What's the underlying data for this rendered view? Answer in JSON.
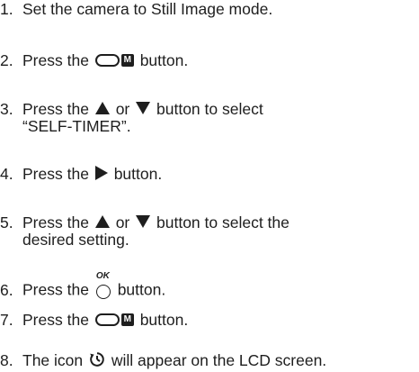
{
  "steps": [
    {
      "number": "1.",
      "text": "Set the camera to Still Image mode."
    },
    {
      "number": "2.",
      "before": "Press the",
      "after": "button.",
      "button_icon": "menu-button-icon",
      "button_letter": "M"
    },
    {
      "number": "3.",
      "before": "Press the",
      "mid": "or",
      "after": "button to select",
      "line2": "“SELF-TIMER”.",
      "icon_a": "up-arrow-icon",
      "icon_b": "down-arrow-icon"
    },
    {
      "number": "4.",
      "before": "Press the",
      "after": "button.",
      "icon": "right-arrow-icon"
    },
    {
      "number": "5.",
      "before": "Press the",
      "mid": "or",
      "after": "button to select the",
      "line2": "desired setting.",
      "icon_a": "up-arrow-icon",
      "icon_b": "down-arrow-icon"
    },
    {
      "number": "6.",
      "before": "Press the",
      "after": "button.",
      "ok_label": "OK",
      "icon": "ok-button-icon"
    },
    {
      "number": "7.",
      "before": "Press the",
      "after": "button.",
      "button_icon": "menu-button-icon",
      "button_letter": "M"
    },
    {
      "number": "8.",
      "before": "The icon",
      "after": "will appear on the LCD screen.",
      "icon": "self-timer-icon"
    }
  ]
}
